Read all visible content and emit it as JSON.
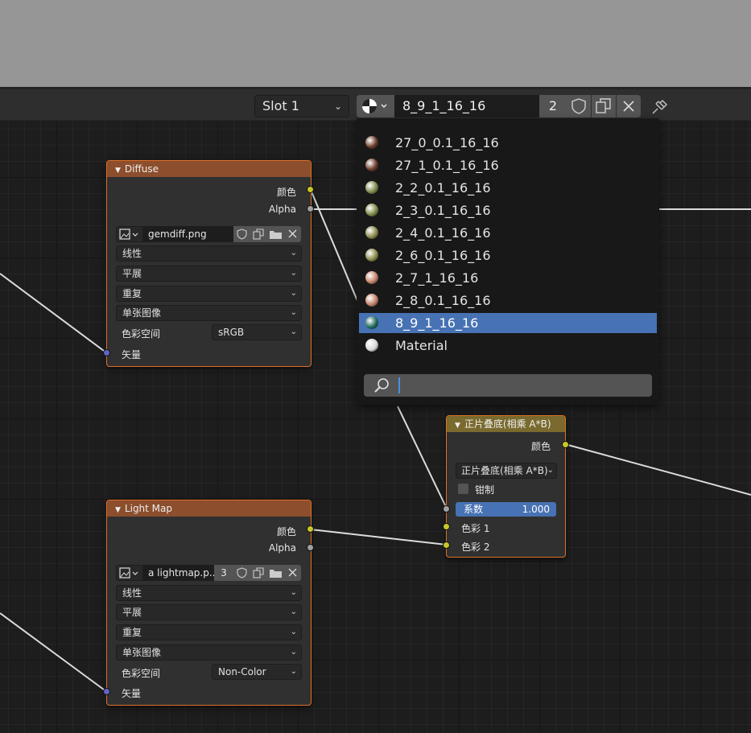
{
  "header": {
    "slot_label": "Slot 1",
    "material_name": "8_9_1_16_16",
    "material_users": "2"
  },
  "material_list": {
    "items": [
      {
        "label": "27_0_0.1_16_16",
        "icon": "material-preview-icon",
        "color": "#6b3b2a"
      },
      {
        "label": "27_1_0.1_16_16",
        "icon": "material-preview-icon",
        "color": "#6b3b2a"
      },
      {
        "label": "2_2_0.1_16_16",
        "icon": "material-preview-icon",
        "color": "#7c8a4a"
      },
      {
        "label": "2_3_0.1_16_16",
        "icon": "material-preview-icon",
        "color": "#7c8a4a"
      },
      {
        "label": "2_4_0.1_16_16",
        "icon": "material-preview-icon",
        "color": "#8a8a4a"
      },
      {
        "label": "2_6_0.1_16_16",
        "icon": "material-preview-icon",
        "color": "#8a8a4a"
      },
      {
        "label": "2_7_1_16_16",
        "icon": "material-preview-icon",
        "color": "#c48067"
      },
      {
        "label": "2_8_0.1_16_16",
        "icon": "material-preview-icon",
        "color": "#c48067"
      },
      {
        "label": "8_9_1_16_16",
        "icon": "material-preview-icon",
        "color": "#1f6b5a",
        "selected": true
      },
      {
        "label": "Material",
        "icon": "material-preview-icon",
        "color": "#d8d8d8"
      }
    ],
    "search_value": ""
  },
  "node_diffuse": {
    "title": "Diffuse",
    "out_color": "颜色",
    "out_alpha": "Alpha",
    "image_name": "gemdiff.png",
    "interpolation": "线性",
    "projection": "平展",
    "extension": "重复",
    "source": "单张图像",
    "colorspace_label": "色彩空间",
    "colorspace_value": "sRGB",
    "in_vector": "矢量"
  },
  "node_lightmap": {
    "title": "Light Map",
    "out_color": "颜色",
    "out_alpha": "Alpha",
    "image_name": "a lightmap.p..",
    "image_users": "3",
    "interpolation": "线性",
    "projection": "平展",
    "extension": "重复",
    "source": "单张图像",
    "colorspace_label": "色彩空间",
    "colorspace_value": "Non-Color",
    "in_vector": "矢量"
  },
  "node_mix": {
    "title": "正片叠底(相乘 A*B)",
    "out_color": "颜色",
    "blend_mode": "正片叠底(相乘 A*B)",
    "clamp_label": "钳制",
    "factor_label": "系数",
    "factor_value": "1.000",
    "in_color1": "色彩 1",
    "in_color2": "色彩 2"
  },
  "colors": {
    "accent": "#4772b3",
    "node_border": "#e06f27",
    "texture_header": "#8c4e2d",
    "mix_header": "#7a6a2e",
    "socket_color": "#c7c729",
    "socket_float": "#a1a1a1",
    "socket_vector": "#6363c7"
  }
}
